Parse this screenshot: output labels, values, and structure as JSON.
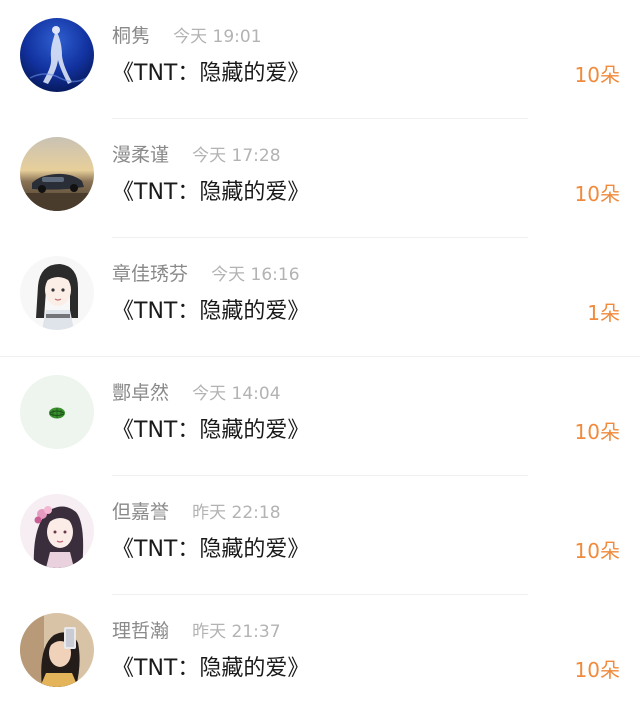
{
  "colors": {
    "count_orange": "#f08a3c",
    "name_gray": "#8a8a8a",
    "time_gray": "#b3b3b3"
  },
  "entries": [
    {
      "name": "桐隽",
      "time": "今天 19:01",
      "gift": "《TNT：隐藏的爱》",
      "count": "10朵",
      "avatar": "deep-sea-diver-avatar"
    },
    {
      "name": "漫柔谨",
      "time": "今天 17:28",
      "gift": "《TNT：隐藏的爱》",
      "count": "10朵",
      "avatar": "sports-car-sunset-avatar"
    },
    {
      "name": "章佳琇芬",
      "time": "今天 16:16",
      "gift": "《TNT：隐藏的爱》",
      "count": "1朵",
      "avatar": "anime-girl-sketch-avatar"
    },
    {
      "name": "酆卓然",
      "time": "今天 14:04",
      "gift": "《TNT：隐藏的爱》",
      "count": "10朵",
      "avatar": "watermelon-avatar"
    },
    {
      "name": "但嘉誉",
      "time": "昨天 22:18",
      "gift": "《TNT：隐藏的爱》",
      "count": "10朵",
      "avatar": "anime-princess-avatar"
    },
    {
      "name": "理哲瀚",
      "time": "昨天 21:37",
      "gift": "《TNT：隐藏的爱》",
      "count": "10朵",
      "avatar": "selfie-girl-avatar"
    }
  ]
}
